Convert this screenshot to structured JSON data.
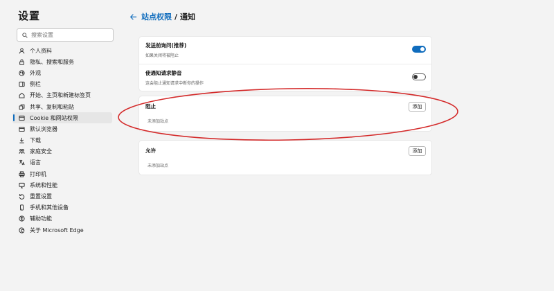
{
  "sidebar": {
    "title": "设置",
    "search_placeholder": "搜索设置",
    "items": [
      {
        "label": "个人资料",
        "icon": "profile-icon"
      },
      {
        "label": "隐私、搜索和服务",
        "icon": "lock-icon"
      },
      {
        "label": "外观",
        "icon": "appearance-icon"
      },
      {
        "label": "侧栏",
        "icon": "sidebar-icon"
      },
      {
        "label": "开始、主页和新建标签页",
        "icon": "home-icon"
      },
      {
        "label": "共享、复制和粘贴",
        "icon": "share-icon"
      },
      {
        "label": "Cookie 和网站权限",
        "icon": "site-permissions-icon",
        "active": true
      },
      {
        "label": "默认浏览器",
        "icon": "browser-icon"
      },
      {
        "label": "下载",
        "icon": "download-icon"
      },
      {
        "label": "家庭安全",
        "icon": "family-icon"
      },
      {
        "label": "语言",
        "icon": "language-icon"
      },
      {
        "label": "打印机",
        "icon": "printer-icon"
      },
      {
        "label": "系统和性能",
        "icon": "system-icon"
      },
      {
        "label": "重置设置",
        "icon": "reset-icon"
      },
      {
        "label": "手机和其他设备",
        "icon": "phone-icon"
      },
      {
        "label": "辅助功能",
        "icon": "accessibility-icon"
      },
      {
        "label": "关于 Microsoft Edge",
        "icon": "edge-icon"
      }
    ]
  },
  "header": {
    "parent": "站点权限",
    "separator": "/",
    "current": "通知"
  },
  "notifications": {
    "ask_before_sending": {
      "title": "发送前询问(推荐)",
      "desc": "如果关闭将被阻止",
      "enabled": true
    },
    "quiet_requests": {
      "title": "使通知请求静音",
      "desc": "这会阻止通知请求中断你的操作",
      "enabled": false
    }
  },
  "block_section": {
    "title": "阻止",
    "add_label": "添加",
    "empty_text": "未添加站点"
  },
  "allow_section": {
    "title": "允许",
    "add_label": "添加",
    "empty_text": "未添加站点"
  },
  "colors": {
    "accent": "#0f6cbd",
    "annotation": "#d42a2a",
    "background": "#f3f3f3"
  }
}
